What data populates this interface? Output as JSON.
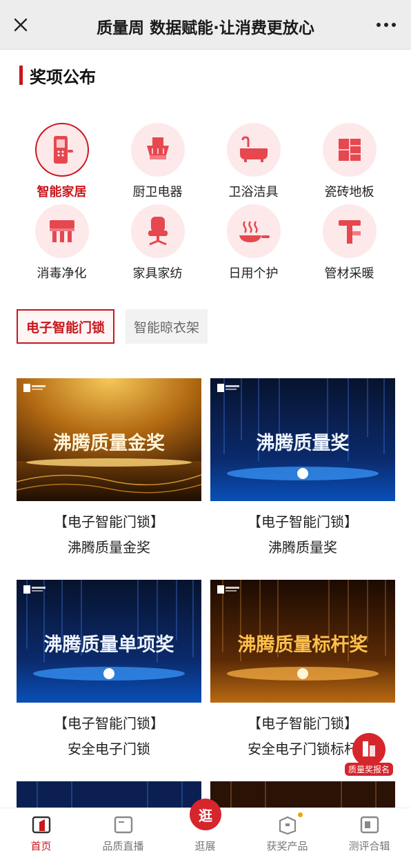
{
  "titlebar": {
    "title": "质量周 数据赋能·让消费更放心"
  },
  "section": {
    "title": "奖项公布"
  },
  "categories": [
    {
      "label": "智能家居",
      "icon": "smart-lock-icon",
      "active": true
    },
    {
      "label": "厨卫电器",
      "icon": "range-hood-icon",
      "active": false
    },
    {
      "label": "卫浴洁具",
      "icon": "bathtub-icon",
      "active": false
    },
    {
      "label": "瓷砖地板",
      "icon": "tile-icon",
      "active": false
    },
    {
      "label": "消毒净化",
      "icon": "purifier-icon",
      "active": false
    },
    {
      "label": "家具家纺",
      "icon": "chair-icon",
      "active": false
    },
    {
      "label": "日用个护",
      "icon": "pan-icon",
      "active": false
    },
    {
      "label": "管材采暖",
      "icon": "pipe-icon",
      "active": false
    }
  ],
  "subtabs": [
    {
      "label": "电子智能门锁",
      "active": true
    },
    {
      "label": "智能晾衣架",
      "active": false
    }
  ],
  "cards": [
    {
      "overlay": "沸腾质量金奖",
      "category": "【电子智能门锁】",
      "name": "沸腾质量金奖",
      "theme": "gold"
    },
    {
      "overlay": "沸腾质量奖",
      "category": "【电子智能门锁】",
      "name": "沸腾质量奖",
      "theme": "blue"
    },
    {
      "overlay": "沸腾质量单项奖",
      "category": "【电子智能门锁】",
      "name": "安全电子门锁",
      "theme": "blue"
    },
    {
      "overlay": "沸腾质量标杆奖",
      "category": "【电子智能门锁】",
      "name": "安全电子门锁标杆",
      "theme": "orange"
    }
  ],
  "float_button": {
    "label": "质量奖报名"
  },
  "bottom_nav": [
    {
      "label": "首页",
      "active": true
    },
    {
      "label": "品质直播",
      "active": false
    },
    {
      "label": "逛展",
      "active": false,
      "center_text": "逛"
    },
    {
      "label": "获奖产品",
      "active": false
    },
    {
      "label": "测评合辑",
      "active": false
    }
  ],
  "colors": {
    "accent": "#c8161d",
    "icon_bg": "#fde9ea",
    "icon_fg": "#e5484f"
  }
}
